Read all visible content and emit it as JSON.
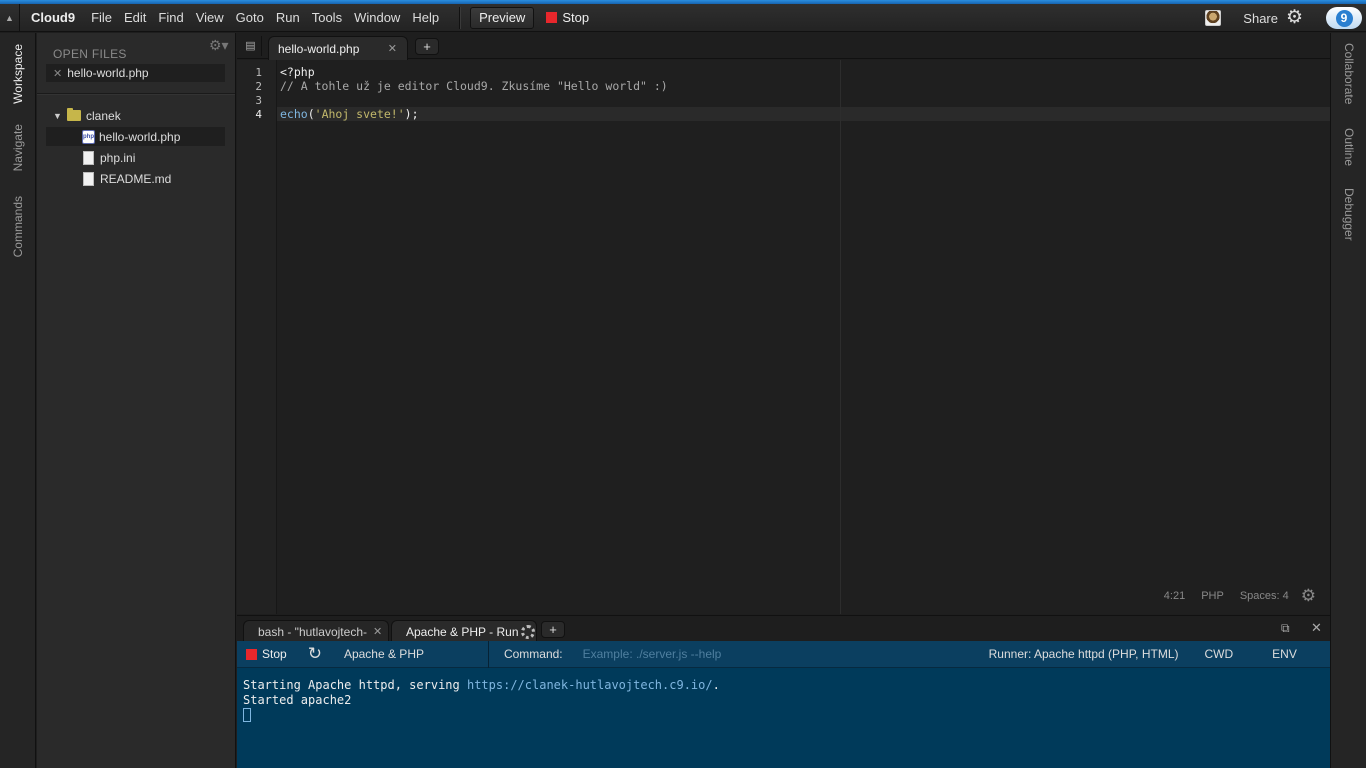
{
  "menubar": {
    "collapse_icon": "chevron-up-icon",
    "brand": "Cloud9",
    "items": [
      "File",
      "Edit",
      "Find",
      "View",
      "Goto",
      "Run",
      "Tools",
      "Window",
      "Help"
    ],
    "preview_label": "Preview",
    "stop_label": "Stop",
    "share_label": "Share"
  },
  "left_panel_tabs": [
    "Workspace",
    "Navigate",
    "Commands"
  ],
  "right_panel_tabs": [
    "Collaborate",
    "Outline",
    "Debugger"
  ],
  "sidebar": {
    "open_files_title": "OPEN FILES",
    "open_files": [
      "hello-world.php"
    ],
    "tree": {
      "folder": "clanek",
      "files": [
        "hello-world.php",
        "php.ini",
        "README.md"
      ]
    },
    "php_badge": "php"
  },
  "editor": {
    "tab_label": "hello-world.php",
    "line_numbers": [
      "1",
      "2",
      "3",
      "4"
    ],
    "lines": {
      "l1": "<?php",
      "l2": "// A tohle už je editor Cloud9. Zkusíme \"Hello world\" :)",
      "l3": "",
      "l4_fn": "echo",
      "l4_open": "(",
      "l4_str": "'Ahoj svete!'",
      "l4_close": ");"
    },
    "status": {
      "cursor": "4:21",
      "language": "PHP",
      "indent": "Spaces: 4"
    }
  },
  "console": {
    "tabs": [
      {
        "label": "bash - \"hutlavojtech-"
      },
      {
        "label": "Apache & PHP - Run"
      }
    ],
    "runner_bar": {
      "stop_label": "Stop",
      "runner_name": "Apache & PHP",
      "command_label": "Command:",
      "command_placeholder": "Example: ./server.js --help",
      "runner_select": "Runner: Apache httpd (PHP, HTML)",
      "cwd_label": "CWD",
      "env_label": "ENV"
    },
    "output": {
      "line1_prefix": "Starting Apache httpd, serving ",
      "line1_link": "https://clanek-hutlavojtech.c9.io/",
      "line1_suffix": ".",
      "line2": "Started apache2"
    }
  },
  "colors": {
    "accent": "#2a8ee0",
    "stop_red": "#e8272c",
    "terminal_bg": "#003a5a",
    "string": "#c2b86b",
    "keyword": "#7fb6e0",
    "comment": "#a8a8a8"
  }
}
